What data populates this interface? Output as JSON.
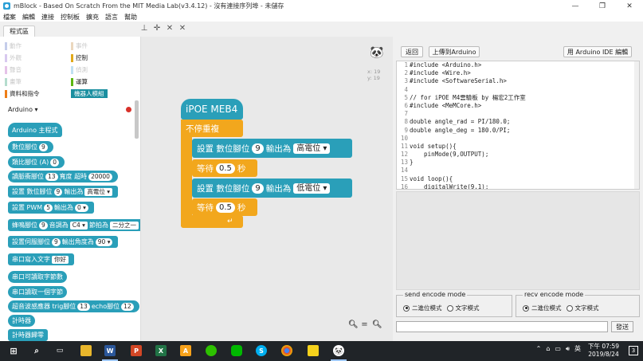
{
  "window": {
    "title": "mBlock - Based On Scratch From the MIT Media Lab(v3.4.12) - 沒有連接序列埠 - 未儲存",
    "minimize": "—",
    "maximize": "❐",
    "close": "✕"
  },
  "menu": [
    "檔案",
    "編輯",
    "連接",
    "控制板",
    "擴充",
    "語言",
    "幫助"
  ],
  "tabs": {
    "program": "程式區"
  },
  "categories": [
    {
      "label": "動作",
      "color": "#4a6cd4",
      "dim": true
    },
    {
      "label": "事件",
      "color": "#c88330",
      "dim": true
    },
    {
      "label": "外觀",
      "color": "#8a55d7",
      "dim": true
    },
    {
      "label": "控制",
      "color": "#e1a91a",
      "dim": false
    },
    {
      "label": "聲音",
      "color": "#bb42c3",
      "dim": true
    },
    {
      "label": "偵測",
      "color": "#2ca5e2",
      "dim": true
    },
    {
      "label": "畫筆",
      "color": "#0e9a6c",
      "dim": true
    },
    {
      "label": "運算",
      "color": "#5cb712",
      "dim": false
    },
    {
      "label": "資料和指令",
      "color": "#ee7d16",
      "dim": false
    },
    {
      "label": "機器人模組",
      "color": "#1a8fa0",
      "dim": false,
      "selected": true
    }
  ],
  "palette": {
    "extension_header": "Arduino ▾",
    "blocks": {
      "main_program": "Arduino 主程式",
      "digital_pin": {
        "text": "數位腳位",
        "pin": "9"
      },
      "analog_pin": {
        "text": "類比腳位 (A)",
        "pin": "0"
      },
      "pulse": {
        "text_a": "讀脈衝腳位",
        "pin": "13",
        "text_b": "寬度 超時",
        "timeout": "20000"
      },
      "set_digital": {
        "text_a": "設置 數位腳位",
        "pin": "9",
        "text_b": "輸出為",
        "value": "高電位"
      },
      "set_pwm": {
        "text_a": "設置 PWM",
        "pin": "5",
        "text_b": "輸出為",
        "value": "0"
      },
      "buzzer": {
        "text_a": "蜂鳴腳位",
        "pin": "9",
        "text_b": "音調為",
        "tone": "C4",
        "text_c": "節拍為",
        "beat": "二分之一"
      },
      "servo": {
        "text_a": "設置伺服腳位",
        "pin": "9",
        "text_b": "輸出角度為",
        "angle": "90"
      },
      "serial_write": {
        "text": "串口寫入文字",
        "value": "你好"
      },
      "serial_available": "串口可讀取字節數",
      "serial_read": "串口讀取一個字節",
      "ultrasonic": {
        "text_a": "超音波感應器 trig腳位",
        "trig": "13",
        "text_b": "echo腳位",
        "echo": "12"
      },
      "timer": "計時器",
      "reset_timer": "計時器歸零"
    }
  },
  "script": {
    "hat": "iPOE MEB4",
    "forever": "不停重複",
    "set1": {
      "text_a": "設置 數位腳位",
      "pin": "9",
      "text_b": "輸出為",
      "value": "高電位"
    },
    "wait1": {
      "text_a": "等待",
      "value": "0.5",
      "text_b": "秒"
    },
    "set2": {
      "text_a": "設置 數位腳位",
      "pin": "9",
      "text_b": "輸出為",
      "value": "低電位"
    },
    "wait2": {
      "text_a": "等待",
      "value": "0.5",
      "text_b": "秒"
    },
    "coord_x": "x: 19",
    "coord_y": "y: 19"
  },
  "right": {
    "back_button": "返回",
    "upload_button": "上傳到Arduino",
    "ide_button": "用 Arduino IDE 編輯",
    "code": [
      {
        "n": "1",
        "t": "#include <Arduino.h>"
      },
      {
        "n": "2",
        "t": "#include <Wire.h>"
      },
      {
        "n": "3",
        "t": "#include <SoftwareSerial.h>"
      },
      {
        "n": "4",
        "t": ""
      },
      {
        "n": "5",
        "t": "// for iPOE M4雲驗板 by 楊宏2工作室"
      },
      {
        "n": "6",
        "t": "#include <MeMCore.h>"
      },
      {
        "n": "7",
        "t": ""
      },
      {
        "n": "8",
        "t": "double angle_rad = PI/180.0;"
      },
      {
        "n": "9",
        "t": "double angle_deg = 180.0/PI;"
      },
      {
        "n": "10",
        "t": ""
      },
      {
        "n": "11",
        "t": "void setup(){"
      },
      {
        "n": "12",
        "t": "    pinMode(9,OUTPUT);"
      },
      {
        "n": "13",
        "t": "}"
      },
      {
        "n": "14",
        "t": ""
      },
      {
        "n": "15",
        "t": "void loop(){"
      },
      {
        "n": "16",
        "t": "    digitalWrite(9,1);"
      }
    ],
    "send_mode": {
      "legend": "send encode mode",
      "opt1": "二進位模式",
      "opt2": "文字模式"
    },
    "recv_mode": {
      "legend": "recv encode mode",
      "opt1": "二進位模式",
      "opt2": "文字模式"
    },
    "send_input_value": "",
    "send_button": "發送"
  },
  "taskbar": {
    "apps": [
      "W",
      "P",
      "X",
      "A",
      "S"
    ],
    "tray_ime": "英",
    "time": "下午 07:59",
    "date": "2019/8/24",
    "notifications": "3"
  }
}
